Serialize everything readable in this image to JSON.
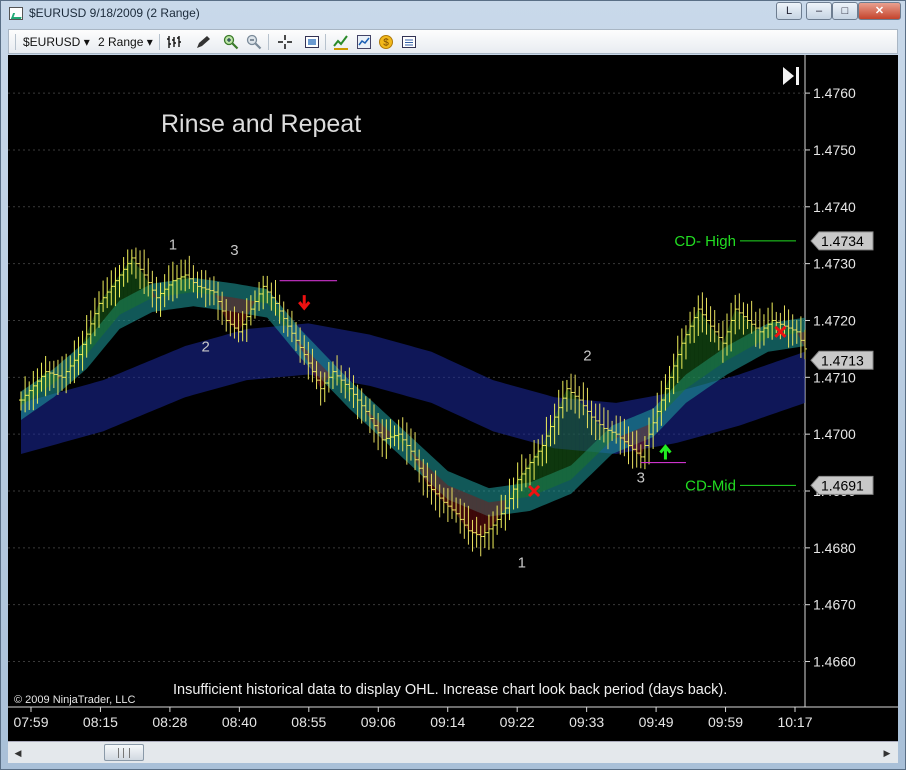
{
  "window": {
    "title": "$EURUSD  9/18/2009 (2 Range)",
    "btn_l": "L",
    "btn_min": "–",
    "btn_max": "□",
    "btn_close": "✕"
  },
  "toolbar": {
    "instrument": "$EURUSD",
    "period": "2 Range",
    "dropdown_icon": "▾"
  },
  "icons": [
    "app-icon",
    "bar-type-icon",
    "drawing-pencil-icon",
    "zoom-in-icon",
    "zoom-out-icon",
    "crosshair-icon",
    "snapshot-icon",
    "indicators-icon",
    "strategies-icon",
    "properties-icon"
  ],
  "scrollbar": {
    "left_arrow": "◀",
    "right_arrow": "▶"
  },
  "chart_data": {
    "type": "candlestick",
    "title": "Rinse and Repeat",
    "ylim": [
      1.4652,
      1.4766
    ],
    "y_ticks": [
      "1.4760",
      "1.4750",
      "1.4740",
      "1.4730",
      "1.4720",
      "1.4710",
      "1.4700",
      "1.4690",
      "1.4680",
      "1.4670",
      "1.4660"
    ],
    "x_ticks": [
      "07:59",
      "08:15",
      "08:28",
      "08:40",
      "08:55",
      "09:06",
      "09:14",
      "09:22",
      "09:33",
      "09:49",
      "09:59",
      "10:17"
    ],
    "grid": true,
    "price_markers": [
      {
        "label": "CD- High",
        "value": 1.4734,
        "price": "1.4734",
        "color": "#22dd22"
      },
      {
        "label": "CD-Mid",
        "value": 1.4691,
        "price": "1.4691",
        "color": "#22dd22"
      },
      {
        "label": "",
        "value": 1.4713,
        "price": "1.4713",
        "color": "#c8c8c8"
      }
    ],
    "close_path": [
      [
        0,
        1.4706
      ],
      [
        6,
        1.4711
      ],
      [
        10,
        1.471
      ],
      [
        14,
        1.4714
      ],
      [
        19,
        1.4723
      ],
      [
        23,
        1.4727
      ],
      [
        27,
        1.4731
      ],
      [
        30,
        1.4728
      ],
      [
        33,
        1.4724
      ],
      [
        37,
        1.4727
      ],
      [
        40,
        1.4728
      ],
      [
        43,
        1.4726
      ],
      [
        47,
        1.4725
      ],
      [
        50,
        1.472
      ],
      [
        53,
        1.4718
      ],
      [
        56,
        1.4722
      ],
      [
        59,
        1.4726
      ],
      [
        62,
        1.4723
      ],
      [
        65,
        1.4719
      ],
      [
        69,
        1.4714
      ],
      [
        73,
        1.4708
      ],
      [
        76,
        1.4711
      ],
      [
        80,
        1.4708
      ],
      [
        84,
        1.4704
      ],
      [
        88,
        1.4699
      ],
      [
        92,
        1.47
      ],
      [
        95,
        1.4697
      ],
      [
        99,
        1.4691
      ],
      [
        103,
        1.4688
      ],
      [
        106,
        1.4686
      ],
      [
        109,
        1.4683
      ],
      [
        112,
        1.4682
      ],
      [
        115,
        1.4684
      ],
      [
        118,
        1.4687
      ],
      [
        121,
        1.4692
      ],
      [
        124,
        1.4695
      ],
      [
        127,
        1.4698
      ],
      [
        130,
        1.4703
      ],
      [
        133,
        1.4708
      ],
      [
        136,
        1.4706
      ],
      [
        139,
        1.4703
      ],
      [
        142,
        1.4701
      ],
      [
        145,
        1.47
      ],
      [
        148,
        1.4698
      ],
      [
        151,
        1.4696
      ],
      [
        154,
        1.4702
      ],
      [
        157,
        1.4708
      ],
      [
        161,
        1.4716
      ],
      [
        165,
        1.4722
      ],
      [
        168,
        1.4719
      ],
      [
        171,
        1.4716
      ],
      [
        174,
        1.4722
      ],
      [
        177,
        1.472
      ],
      [
        180,
        1.4718
      ],
      [
        183,
        1.472
      ],
      [
        186,
        1.4719
      ],
      [
        189,
        1.4718
      ],
      [
        191,
        1.4715
      ]
    ],
    "bands": [
      {
        "name": "",
        "color": "#1fa0a0",
        "width": 0.0005,
        "center": [
          [
            0,
            1.4705
          ],
          [
            8,
            1.4709
          ],
          [
            16,
            1.4714
          ],
          [
            24,
            1.4721
          ],
          [
            32,
            1.4724
          ],
          [
            42,
            1.4725
          ],
          [
            52,
            1.4724
          ],
          [
            60,
            1.4723
          ],
          [
            68,
            1.4716
          ],
          [
            80,
            1.4707
          ],
          [
            92,
            1.4699
          ],
          [
            104,
            1.4691
          ],
          [
            114,
            1.4688
          ],
          [
            124,
            1.4689
          ],
          [
            134,
            1.4692
          ],
          [
            144,
            1.4699
          ],
          [
            154,
            1.4702
          ],
          [
            162,
            1.4708
          ],
          [
            172,
            1.4713
          ],
          [
            182,
            1.4717
          ],
          [
            191,
            1.4718
          ]
        ]
      },
      {
        "name": "",
        "color": "#1c2aa0",
        "width": 0.0009,
        "center": [
          [
            0,
            1.4701
          ],
          [
            20,
            1.4705
          ],
          [
            40,
            1.4711
          ],
          [
            55,
            1.4714
          ],
          [
            70,
            1.4715
          ],
          [
            85,
            1.4713
          ],
          [
            100,
            1.471
          ],
          [
            115,
            1.4705
          ],
          [
            130,
            1.4702
          ],
          [
            145,
            1.4701
          ],
          [
            160,
            1.4703
          ],
          [
            175,
            1.4706
          ],
          [
            191,
            1.471
          ]
        ]
      }
    ],
    "annotations": [
      {
        "text": "1",
        "x": 37,
        "y": 1.47325,
        "color": "#c8c8c8"
      },
      {
        "text": "3",
        "x": 52,
        "y": 1.47315,
        "color": "#c8c8c8"
      },
      {
        "text": "2",
        "x": 45,
        "y": 1.47145,
        "color": "#c8c8c8"
      },
      {
        "text": "2",
        "x": 138,
        "y": 1.4713,
        "color": "#c8c8c8"
      },
      {
        "text": "3",
        "x": 151,
        "y": 1.46915,
        "color": "#c8c8c8"
      },
      {
        "text": "1",
        "x": 122,
        "y": 1.46765,
        "color": "#c8c8c8"
      }
    ],
    "signals": [
      {
        "type": "down-arrow",
        "x": 69,
        "y": 1.4722,
        "color": "#ee1111"
      },
      {
        "type": "up-arrow",
        "x": 157,
        "y": 1.4698,
        "color": "#22ee22"
      },
      {
        "type": "x-mark",
        "x": 125,
        "y": 1.469,
        "color": "#ee1111"
      },
      {
        "type": "x-mark",
        "x": 185,
        "y": 1.4718,
        "color": "#ee1111"
      }
    ],
    "level_lines": [
      {
        "x0": 63,
        "x1": 77,
        "value": 1.4727,
        "color": "#cc33cc"
      },
      {
        "x0": 151,
        "x1": 162,
        "value": 1.4695,
        "color": "#cc33cc"
      }
    ],
    "x_count": 192,
    "copyright": "© 2009 NinjaTrader, LLC",
    "message": "Insufficient historical data to display OHL. Increase chart look back period (days back)."
  }
}
